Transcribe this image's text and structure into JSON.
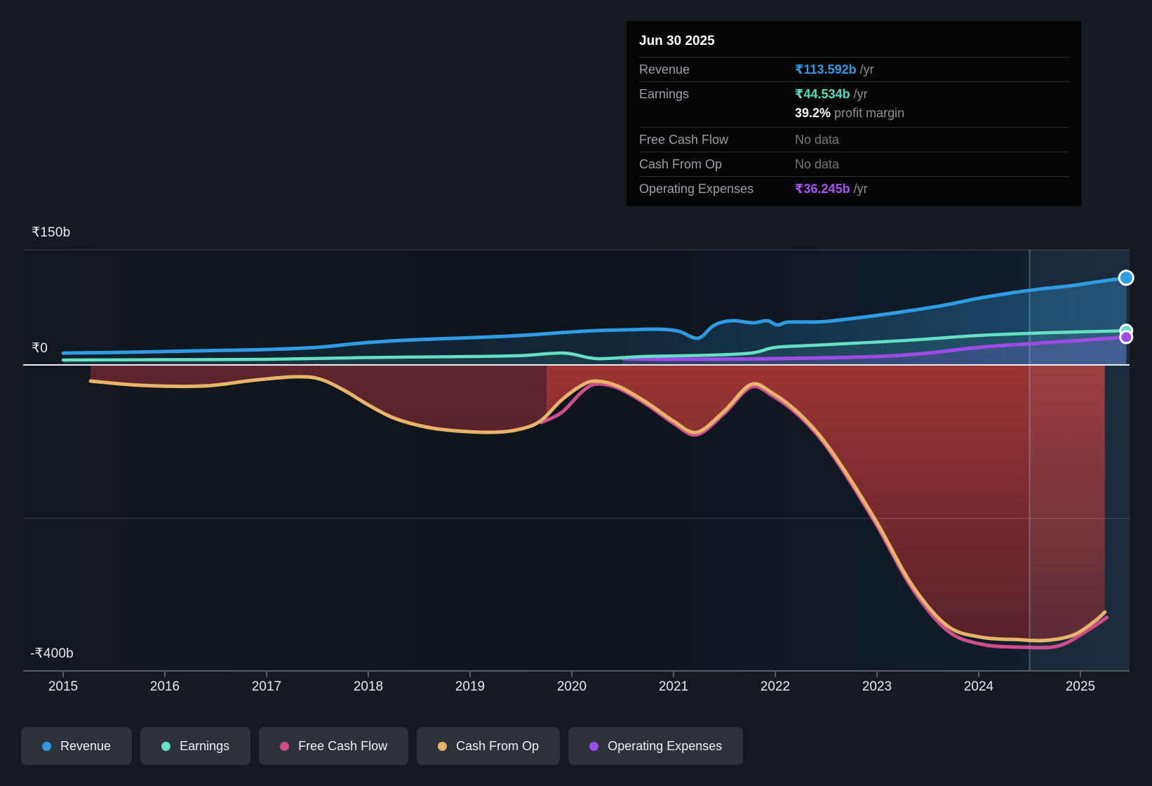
{
  "tooltip": {
    "date": "Jun 30 2025",
    "rows": [
      {
        "label": "Revenue",
        "value": "₹113.592b",
        "unit": "/yr",
        "value_color": "#2e9be2"
      },
      {
        "label": "Earnings",
        "value": "₹44.534b",
        "unit": "/yr",
        "value_color": "#4fe0c2",
        "sub_value": "39.2%",
        "sub_text": "profit margin"
      },
      {
        "label": "Free Cash Flow",
        "value": "No data",
        "no_data": true
      },
      {
        "label": "Cash From Op",
        "value": "No data",
        "no_data": true
      },
      {
        "label": "Operating Expenses",
        "value": "₹36.245b",
        "unit": "/yr",
        "value_color": "#ab52f2"
      }
    ]
  },
  "y_axis": {
    "labels": [
      {
        "text": "₹150b",
        "value": 150
      },
      {
        "text": "₹0",
        "value": 0
      },
      {
        "text": "-₹400b",
        "value": -400
      }
    ]
  },
  "x_axis": {
    "years": [
      "2015",
      "2016",
      "2017",
      "2018",
      "2019",
      "2020",
      "2021",
      "2022",
      "2023",
      "2024",
      "2025"
    ]
  },
  "legend": [
    {
      "label": "Revenue",
      "color": "#2e9be2"
    },
    {
      "label": "Earnings",
      "color": "#65e0c4"
    },
    {
      "label": "Free Cash Flow",
      "color": "#cf4d8c"
    },
    {
      "label": "Cash From Op",
      "color": "#e7b468"
    },
    {
      "label": "Operating Expenses",
      "color": "#9e4ce6"
    }
  ],
  "chart_data": {
    "type": "line",
    "unit": "₹ billions per year",
    "ylim": [
      -400,
      150
    ],
    "x_range": [
      2014.6,
      2025.6
    ],
    "gridlines": [
      150,
      0,
      -200,
      -400
    ],
    "highlight_start_x": 2024.5,
    "fill_split_x": 2019.75,
    "series": [
      {
        "name": "Revenue",
        "color": "#2e9be2",
        "fill": "blue-gradient",
        "end_dot": true,
        "end_dot_r": 10,
        "width": 5,
        "points": [
          [
            2015,
            15.5
          ],
          [
            2015.5,
            16.3
          ],
          [
            2016,
            17.5
          ],
          [
            2016.5,
            18.8
          ],
          [
            2017,
            20.1
          ],
          [
            2017.5,
            23
          ],
          [
            2018,
            29.3
          ],
          [
            2018.5,
            33
          ],
          [
            2019,
            35.5
          ],
          [
            2019.5,
            38.4
          ],
          [
            2020,
            43
          ],
          [
            2020.3,
            45
          ],
          [
            2020.6,
            46
          ],
          [
            2020.86,
            46.6
          ],
          [
            2021.05,
            44
          ],
          [
            2021.24,
            34.8
          ],
          [
            2021.38,
            50
          ],
          [
            2021.48,
            55.8
          ],
          [
            2021.6,
            57.6
          ],
          [
            2021.78,
            54.9
          ],
          [
            2021.92,
            57.6
          ],
          [
            2022.02,
            52.1
          ],
          [
            2022.12,
            55.8
          ],
          [
            2022.3,
            56
          ],
          [
            2022.5,
            56.7
          ],
          [
            2022.97,
            64
          ],
          [
            2023.31,
            70.4
          ],
          [
            2023.66,
            77.8
          ],
          [
            2024,
            86.9
          ],
          [
            2024.34,
            94.2
          ],
          [
            2024.6,
            98.8
          ],
          [
            2024.92,
            103.4
          ],
          [
            2025.2,
            109
          ],
          [
            2025.45,
            113.592
          ]
        ]
      },
      {
        "name": "Earnings",
        "color": "#65e0c4",
        "fill": "rgba(101,224,196,0.10)",
        "end_dot": true,
        "end_dot_r": 8.5,
        "width": 4.5,
        "points": [
          [
            2015,
            6.4
          ],
          [
            2016,
            6.9
          ],
          [
            2017,
            7.3
          ],
          [
            2018,
            9.6
          ],
          [
            2019,
            11
          ],
          [
            2019.5,
            12.2
          ],
          [
            2019.93,
            15.5
          ],
          [
            2020.24,
            8.2
          ],
          [
            2020.7,
            11
          ],
          [
            2021.3,
            12.5
          ],
          [
            2021.76,
            15.5
          ],
          [
            2022,
            22.9
          ],
          [
            2022.38,
            25.6
          ],
          [
            2023.3,
            32
          ],
          [
            2024,
            38.4
          ],
          [
            2024.7,
            42.1
          ],
          [
            2025.45,
            44.534
          ]
        ]
      },
      {
        "name": "Free Cash Flow",
        "color": "#cf4d8c",
        "fill": "none",
        "end_dot": false,
        "width": 5,
        "points": [
          [
            2019.7,
            -75
          ],
          [
            2019.9,
            -62
          ],
          [
            2020.1,
            -35
          ],
          [
            2020.24,
            -25
          ],
          [
            2020.45,
            -30
          ],
          [
            2020.72,
            -50
          ],
          [
            2021,
            -76
          ],
          [
            2021.23,
            -91
          ],
          [
            2021.5,
            -63
          ],
          [
            2021.76,
            -29
          ],
          [
            2021.97,
            -40
          ],
          [
            2022.24,
            -67
          ],
          [
            2022.54,
            -113
          ],
          [
            2022.98,
            -205
          ],
          [
            2023.34,
            -290
          ],
          [
            2023.69,
            -346
          ],
          [
            2024.03,
            -364
          ],
          [
            2024.45,
            -368
          ],
          [
            2024.79,
            -366
          ],
          [
            2025.07,
            -346
          ],
          [
            2025.26,
            -329
          ]
        ]
      },
      {
        "name": "Cash From Op",
        "color": "#e7b468",
        "fill": "split-red",
        "end_dot": false,
        "width": 5,
        "points": [
          [
            2015.27,
            -21
          ],
          [
            2015.76,
            -26.5
          ],
          [
            2016.38,
            -27.4
          ],
          [
            2016.86,
            -20.1
          ],
          [
            2017.28,
            -15.5
          ],
          [
            2017.52,
            -18.3
          ],
          [
            2017.76,
            -32.9
          ],
          [
            2018,
            -52.1
          ],
          [
            2018.24,
            -68.6
          ],
          [
            2018.52,
            -79.6
          ],
          [
            2018.79,
            -85.1
          ],
          [
            2019.21,
            -87.8
          ],
          [
            2019.48,
            -84.1
          ],
          [
            2019.69,
            -73.2
          ],
          [
            2019.9,
            -45.7
          ],
          [
            2020.1,
            -26.5
          ],
          [
            2020.24,
            -21
          ],
          [
            2020.45,
            -27.4
          ],
          [
            2020.72,
            -47.6
          ],
          [
            2021,
            -73.2
          ],
          [
            2021.23,
            -87.8
          ],
          [
            2021.5,
            -60
          ],
          [
            2021.76,
            -25.6
          ],
          [
            2021.97,
            -36.6
          ],
          [
            2022.24,
            -64
          ],
          [
            2022.54,
            -110
          ],
          [
            2022.98,
            -201
          ],
          [
            2023.34,
            -286
          ],
          [
            2023.69,
            -340
          ],
          [
            2024.03,
            -355
          ],
          [
            2024.38,
            -358
          ],
          [
            2024.66,
            -359
          ],
          [
            2024.93,
            -352
          ],
          [
            2025.14,
            -334
          ],
          [
            2025.24,
            -322
          ]
        ]
      },
      {
        "name": "Operating Expenses",
        "color": "#9e4ce6",
        "fill": "rgba(140,85,225,0.22)",
        "end_dot": true,
        "end_dot_r": 8.5,
        "width": 5,
        "points": [
          [
            2020.5,
            8.2
          ],
          [
            2021,
            7.3
          ],
          [
            2022,
            8.2
          ],
          [
            2023,
            11
          ],
          [
            2023.5,
            15.5
          ],
          [
            2024,
            22.9
          ],
          [
            2024.6,
            28.4
          ],
          [
            2025.1,
            32.9
          ],
          [
            2025.45,
            36.245
          ]
        ]
      }
    ]
  }
}
